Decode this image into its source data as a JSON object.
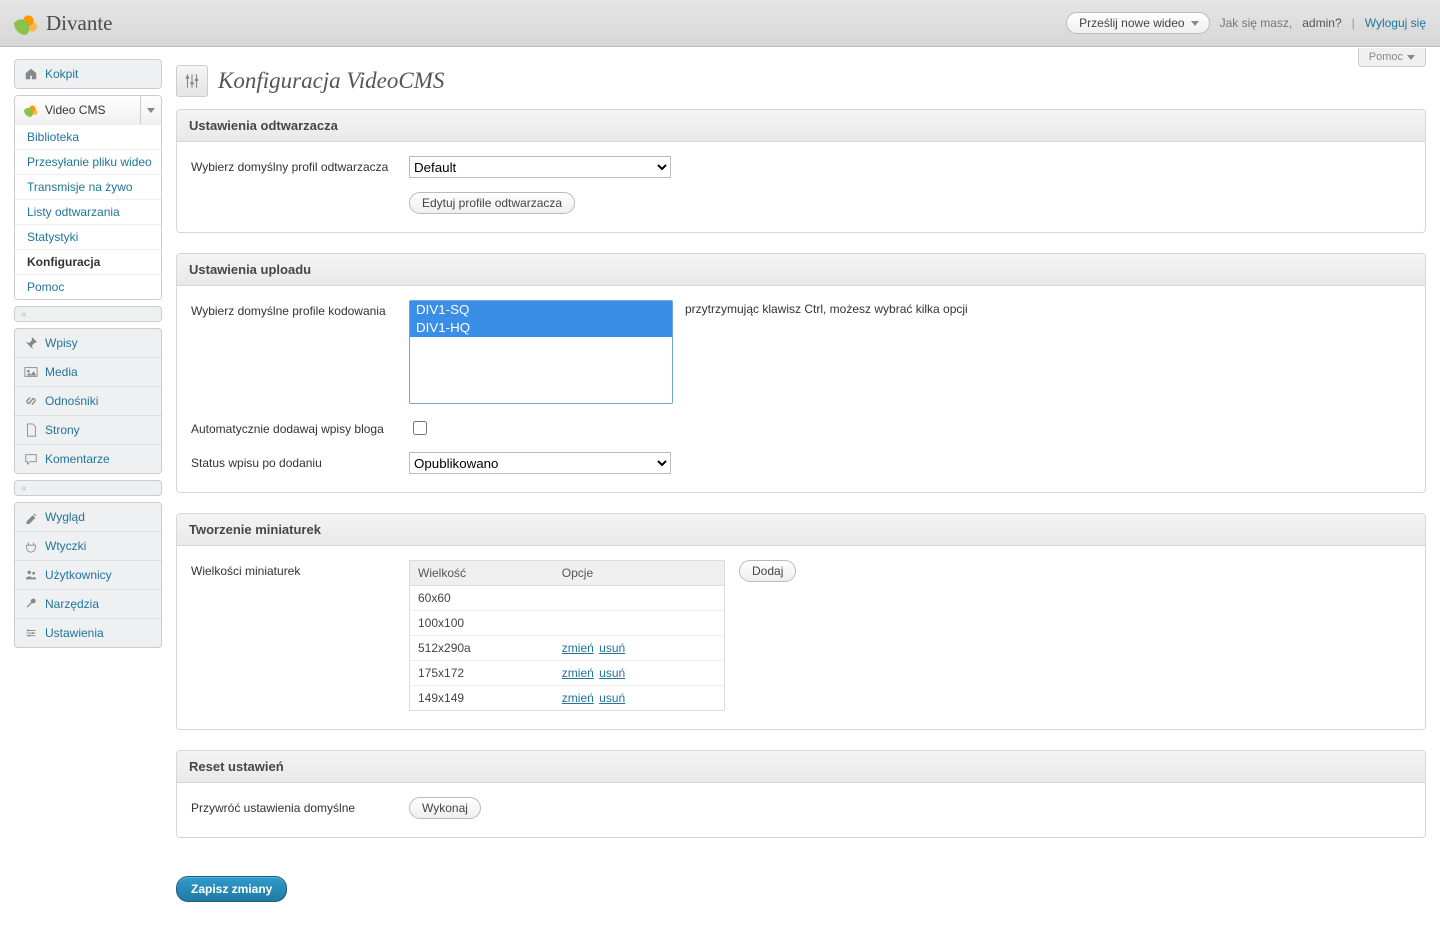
{
  "top": {
    "brand": "Divante",
    "upload_label": "Prześlij nowe wideo",
    "greeting": "Jak się masz,",
    "user": "admin",
    "qmark": "?",
    "sep": "|",
    "logout": "Wyloguj się",
    "help": "Pomoc"
  },
  "sidebar": {
    "dashboard": "Kokpit",
    "videocms": "Video CMS",
    "sub": {
      "library": "Biblioteka",
      "upload": "Przesyłanie pliku wideo",
      "live": "Transmisje na żywo",
      "playlists": "Listy odtwarzania",
      "stats": "Statystyki",
      "config": "Konfiguracja",
      "help": "Pomoc"
    },
    "posts": "Wpisy",
    "media": "Media",
    "links": "Odnośniki",
    "pages": "Strony",
    "comments": "Komentarze",
    "appearance": "Wygląd",
    "plugins": "Wtyczki",
    "users": "Użytkownicy",
    "tools": "Narzędzia",
    "settings": "Ustawienia",
    "collapse": "«"
  },
  "page": {
    "title": "Konfiguracja VideoCMS"
  },
  "player_panel": {
    "title": "Ustawienia odtwarzacza",
    "profile_label": "Wybierz domyślny profil odtwarzacza",
    "profile_value": "Default",
    "edit_button": "Edytuj profile odtwarzacza"
  },
  "upload_panel": {
    "title": "Ustawienia uploadu",
    "enc_label": "Wybierz domyślne profile kodowania",
    "enc_opts": [
      "DIV1-SQ",
      "DIV1-HQ"
    ],
    "enc_hint": "przytrzymując klawisz Ctrl, możesz wybrać kilka opcji",
    "auto_label": "Automatycznie dodawaj wpisy bloga",
    "status_label": "Status wpisu po dodaniu",
    "status_value": "Opublikowano"
  },
  "thumbs_panel": {
    "title": "Tworzenie miniaturek",
    "sizes_label": "Wielkości miniaturek",
    "col_size": "Wielkość",
    "col_ops": "Opcje",
    "change": "zmień",
    "delete": "usuń",
    "add": "Dodaj",
    "rows": [
      {
        "size": "60x60",
        "editable": false
      },
      {
        "size": "100x100",
        "editable": false
      },
      {
        "size": "512x290a",
        "editable": true
      },
      {
        "size": "175x172",
        "editable": true
      },
      {
        "size": "149x149",
        "editable": true
      }
    ]
  },
  "reset_panel": {
    "title": "Reset ustawień",
    "label": "Przywróć ustawienia domyślne",
    "button": "Wykonaj"
  },
  "save_button": "Zapisz zmiany"
}
